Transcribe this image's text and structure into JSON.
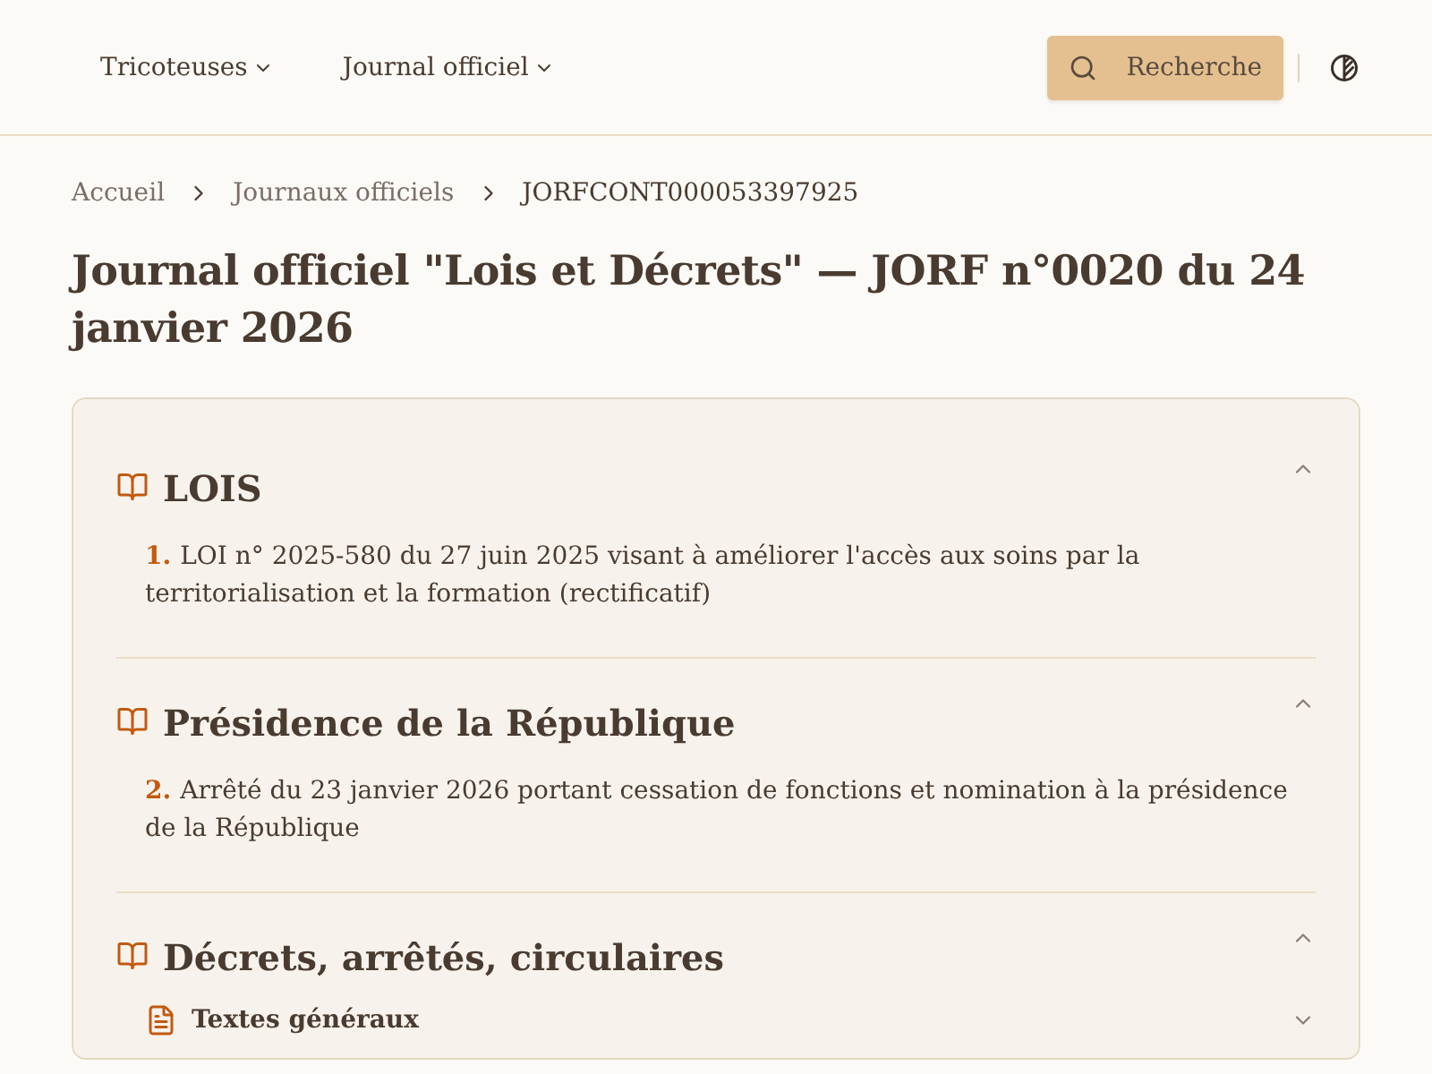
{
  "nav": {
    "menus": [
      "Tricoteuses",
      "Journal officiel"
    ],
    "search_button": "Recherche"
  },
  "breadcrumb": [
    {
      "label": "Accueil",
      "current": false
    },
    {
      "label": "Journaux officiels",
      "current": false
    },
    {
      "label": "JORFCONT000053397925",
      "current": true
    }
  ],
  "title": "Journal officiel \"Lois et Décrets\" — JORF n°0020 du 24 janvier 2026",
  "sections": [
    {
      "title": "LOIS",
      "expanded": true,
      "items": [
        {
          "number": "1.",
          "text": "LOI n° 2025-580 du 27 juin 2025 visant à améliorer l'accès aux soins par la territorialisation et la formation (rectificatif)"
        }
      ]
    },
    {
      "title": "Présidence de la République",
      "expanded": true,
      "items": [
        {
          "number": "2.",
          "text": "Arrêté du 23 janvier 2026 portant cessation de fonctions et nomination à la présidence de la République"
        }
      ]
    },
    {
      "title": "Décrets, arrêtés, circulaires",
      "expanded": true,
      "subsections": [
        {
          "title": "Textes généraux",
          "expanded": false
        }
      ]
    }
  ]
}
